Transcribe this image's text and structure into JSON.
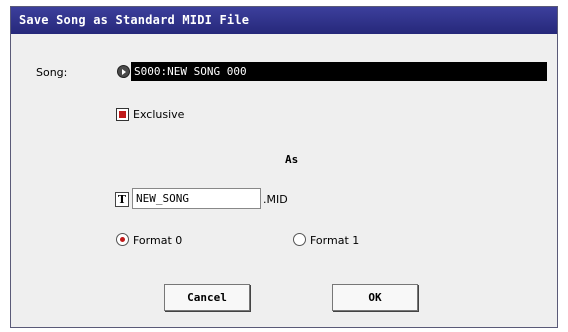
{
  "dialog": {
    "title": "Save Song as Standard MIDI File"
  },
  "song": {
    "label": "Song:",
    "value": "S000:NEW SONG 000"
  },
  "exclusive": {
    "label": "Exclusive",
    "checked": true
  },
  "as_label": "As",
  "filename": {
    "text_button": "T",
    "value": "NEW_SONG",
    "extension": ".MID"
  },
  "formats": [
    {
      "label": "Format 0",
      "selected": true
    },
    {
      "label": "Format 1",
      "selected": false
    }
  ],
  "buttons": {
    "cancel": "Cancel",
    "ok": "OK"
  },
  "colors": {
    "title_bar": "#2f3190",
    "accent": "#c01a1a"
  }
}
